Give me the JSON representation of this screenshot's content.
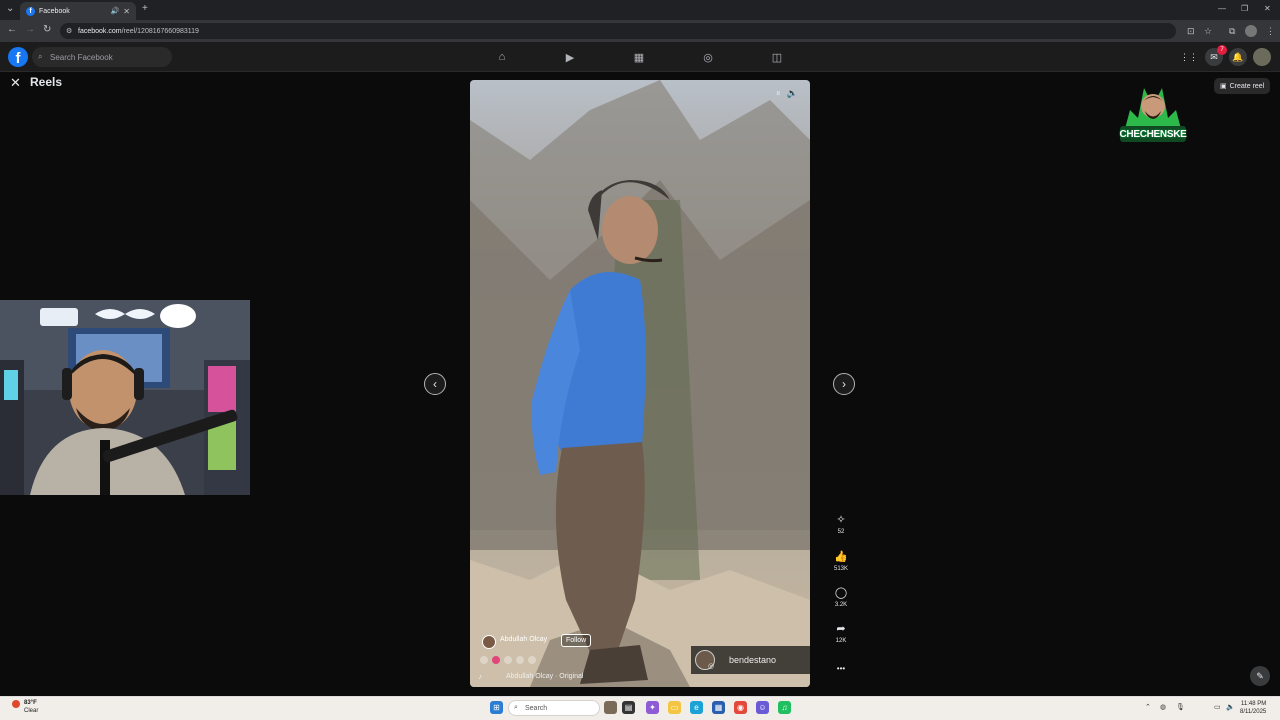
{
  "browser": {
    "tab_title": "Facebook",
    "url_host": "facebook.com",
    "url_path": "/reel/1208167660983119",
    "new_tab": "+",
    "minimize": "—",
    "restore": "❐",
    "close": "✕"
  },
  "facebook": {
    "search_placeholder": "Search Facebook",
    "logo_letter": "f",
    "notification_count": "7"
  },
  "reels": {
    "title": "Reels",
    "create_label": "Create reel",
    "author": "Abdullah Olcay",
    "follow_label": "Follow",
    "audio": "Abdullah Olcay · Original",
    "watermark_name": "bendestano",
    "actions": [
      {
        "icon": "sparkle-icon",
        "glyph": "✧",
        "count": "52"
      },
      {
        "icon": "like-icon",
        "glyph": "👍",
        "count": "513K"
      },
      {
        "icon": "comment-icon",
        "glyph": "◯",
        "count": "3.2K"
      },
      {
        "icon": "share-icon",
        "glyph": "➦",
        "count": "12K"
      }
    ],
    "more_glyph": "•••"
  },
  "overlay_logo": {
    "text": "CHECHENSKE"
  },
  "taskbar": {
    "weather_temp": "83°F",
    "weather_desc": "Clear",
    "search_placeholder": "Search",
    "time": "11:48 PM",
    "date": "8/11/2025"
  },
  "colors": {
    "facebook_blue": "#1877f2",
    "dark_bg": "#0b0b0b",
    "fb_bar": "#1c1c1d",
    "taskbar": "#f1eee9"
  }
}
